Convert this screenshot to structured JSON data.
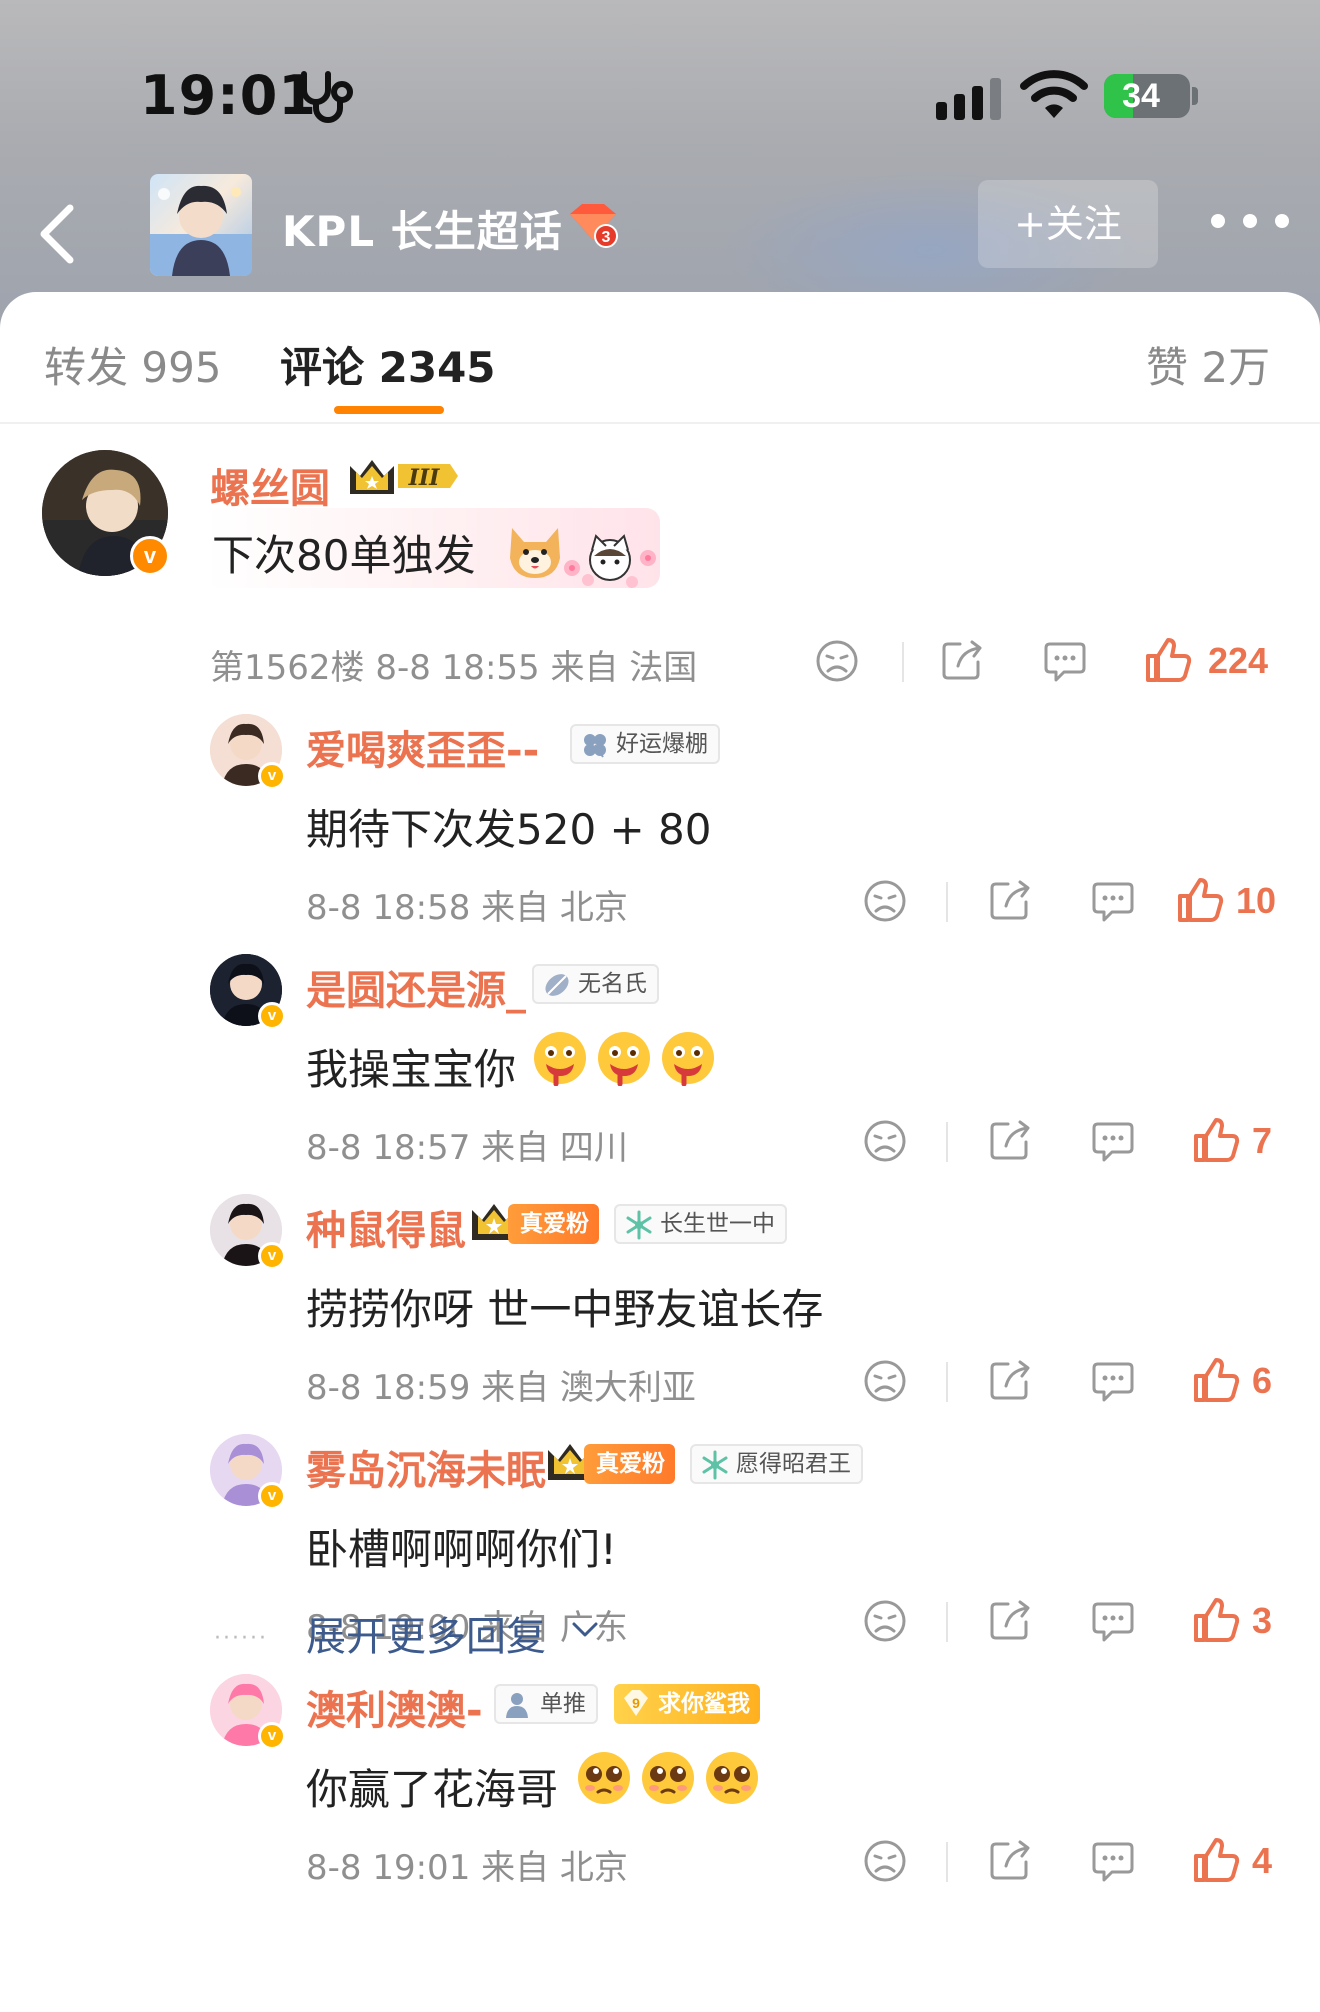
{
  "status_bar": {
    "time": "19:01",
    "battery": "34",
    "battery_fraction": 0.34
  },
  "header": {
    "topic_title": "KPL 长生超话",
    "topic_level": "3",
    "follow_label": "+关注"
  },
  "tabs": {
    "repost": "转发 995",
    "comment": "评论 2345",
    "like": "赞 2万"
  },
  "main_comment": {
    "username": "螺丝圆",
    "crown_level": "III",
    "text": "下次80单独发",
    "meta": "第1562楼  8-8 18:55  来自 法国",
    "likes": "224"
  },
  "replies": [
    {
      "username": "爱喝爽歪歪--",
      "badges": [
        {
          "icon": "clover-icon",
          "label": "好运爆棚"
        }
      ],
      "text": "期待下次发520 + 80",
      "meta": "8-8 18:58  来自 北京",
      "likes": "10"
    },
    {
      "username": "是圆还是源_",
      "badges": [
        {
          "icon": "feather-icon",
          "label": "无名氏"
        }
      ],
      "text": "我操宝宝你",
      "emojis": [
        "drool-emoji",
        "drool-emoji",
        "drool-emoji"
      ],
      "meta": "8-8 18:57  来自 四川",
      "likes": "7"
    },
    {
      "username": "种鼠得鼠",
      "fan_badge": "真爱粉",
      "badges": [
        {
          "icon": "snowflake-icon",
          "label": "长生世一中"
        }
      ],
      "text": "捞捞你呀 世一中野友谊长存",
      "meta": "8-8 18:59  来自 澳大利亚",
      "likes": "6"
    },
    {
      "username": "雾岛沉海未眠",
      "fan_badge": "真爱粉",
      "badges": [
        {
          "icon": "snowflake-icon",
          "label": "愿得昭君王"
        }
      ],
      "text": "卧槽啊啊啊你们!",
      "meta": "8-8 19:00  来自 广东",
      "likes": "3"
    },
    {
      "username": "澳利澳澳-",
      "badges": [
        {
          "icon": "person-icon",
          "label": "单推"
        }
      ],
      "fan_badge_gold": "求你鲨我",
      "fan_badge_gold_level": "9",
      "text": "你赢了花海哥",
      "emojis": [
        "pleading-emoji",
        "pleading-emoji",
        "pleading-emoji"
      ],
      "meta": "8-8 19:01  来自 北京",
      "likes": "4"
    }
  ],
  "expand_label": "展开更多回复",
  "colors": {
    "accent": "#ff8200",
    "username": "#eb7350",
    "link": "#3d5a8c"
  }
}
